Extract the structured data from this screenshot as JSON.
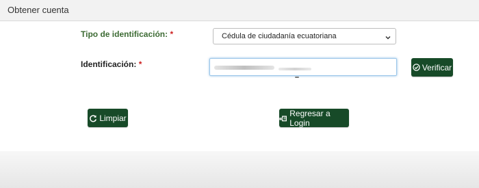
{
  "header": {
    "title": "Obtener cuenta"
  },
  "form": {
    "tipo_label": "Tipo de identificación:",
    "ident_label": "Identificación:",
    "required_mark": "*",
    "tipo_selected": "Cédula de ciudadanía ecuatoriana",
    "ident_value": ""
  },
  "buttons": {
    "verificar": "Verificar",
    "limpiar": "Limpiar",
    "regresar": "Regresar a Login"
  },
  "icons": {
    "verificar": "check-circle-icon",
    "limpiar": "refresh-icon",
    "regresar": "hand-pointer-icon",
    "select_arrow": "chevron-down-icon"
  },
  "colors": {
    "button_bg": "#174a28",
    "label_green": "#3d6b34",
    "required_red": "#cc1f1f"
  }
}
